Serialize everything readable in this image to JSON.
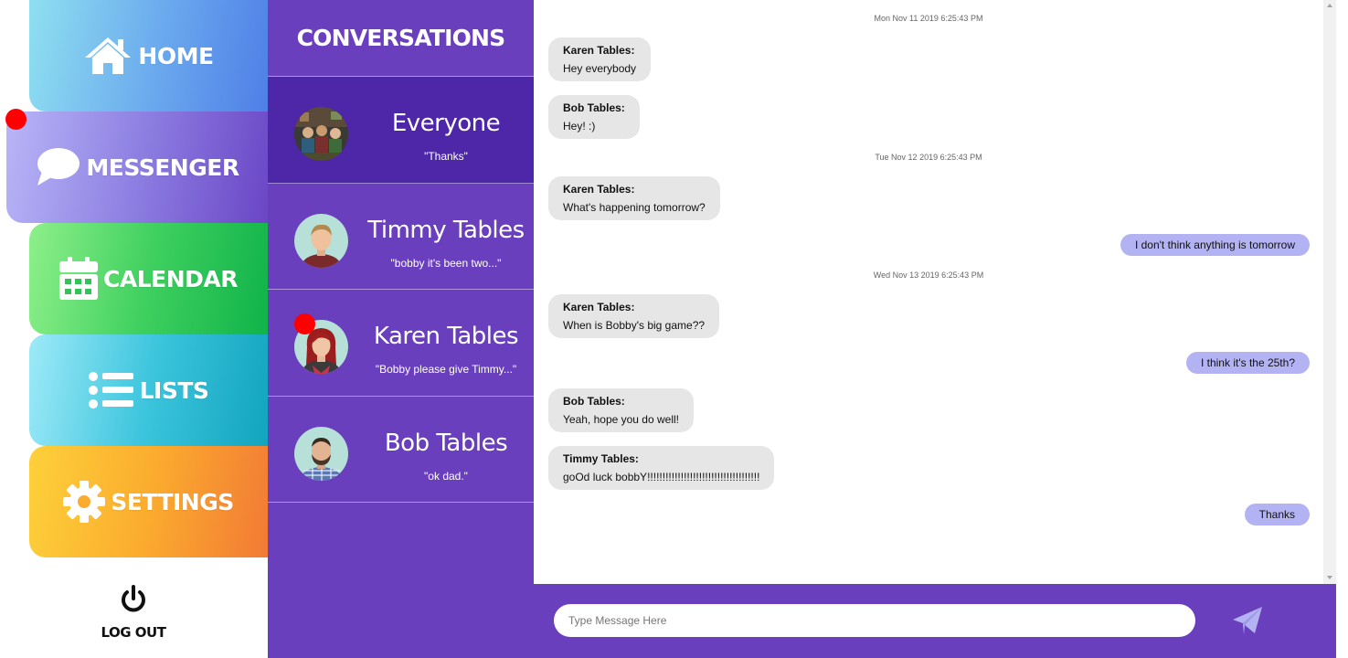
{
  "nav": {
    "home": {
      "label": "HOME",
      "icon": "home-icon"
    },
    "messenger": {
      "label": "MESSENGER",
      "icon": "chat-bubble-icon",
      "has_notification": true
    },
    "calendar": {
      "label": "CALENDAR",
      "icon": "calendar-icon"
    },
    "lists": {
      "label": "LISTS",
      "icon": "list-icon"
    },
    "settings": {
      "label": "SETTINGS",
      "icon": "gear-icon"
    },
    "logout": {
      "label": "LOG OUT",
      "icon": "power-icon"
    }
  },
  "conversations": {
    "title": "CONVERSATIONS",
    "items": [
      {
        "name": "Everyone",
        "preview": "\"Thanks\"",
        "active": true,
        "unread": false
      },
      {
        "name": "Timmy Tables",
        "preview": "\"bobby it's been two...\"",
        "active": false,
        "unread": false
      },
      {
        "name": "Karen Tables",
        "preview": "\"Bobby please give Timmy...\"",
        "active": false,
        "unread": true
      },
      {
        "name": "Bob Tables",
        "preview": "\"ok dad.\"",
        "active": false,
        "unread": false
      }
    ]
  },
  "chat": {
    "timestamps": [
      "Mon Nov 11 2019 6:25:43 PM",
      "Tue Nov 12 2019 6:25:43 PM",
      "Wed Nov 13 2019 6:25:43 PM"
    ],
    "messages": [
      {
        "sender": "Karen Tables:",
        "text": "Hey everybody"
      },
      {
        "sender": "Bob Tables:",
        "text": "Hey! :)"
      },
      {
        "sender": "Karen Tables:",
        "text": "What's happening tomorrow?"
      },
      {
        "text": "I don't think anything is tomorrow"
      },
      {
        "sender": "Karen Tables:",
        "text": "When is Bobby's big game??"
      },
      {
        "text": "I think it's the 25th?"
      },
      {
        "sender": "Bob Tables:",
        "text": "Yeah, hope you do well!"
      },
      {
        "sender": "Timmy Tables:",
        "text": "goOd luck bobbY!!!!!!!!!!!!!!!!!!!!!!!!!!!!!!!!!!!!!"
      },
      {
        "text": "Thanks"
      }
    ]
  },
  "compose": {
    "placeholder": "Type Message Here",
    "send_icon": "paper-plane-icon"
  },
  "colors": {
    "panel_purple": "#6a3fbe",
    "active_purple": "#4e27a8",
    "my_bubble": "#b3b3f3",
    "other_bubble": "#e6e6e6",
    "notification": "#ff0000"
  }
}
